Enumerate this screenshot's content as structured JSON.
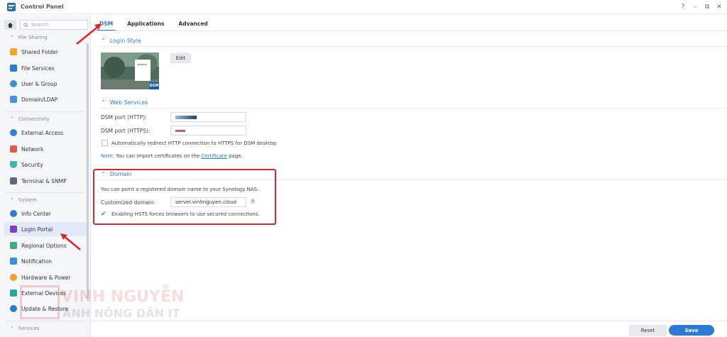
{
  "window": {
    "title": "Control Panel",
    "controls": [
      "?",
      "–",
      "⧉",
      "✕"
    ]
  },
  "sidebar": {
    "search_placeholder": "Search",
    "groups": [
      {
        "label": "File Sharing",
        "items": [
          {
            "label": "Shared Folder",
            "icon": "shared-folder-icon",
            "color": "#f5a623"
          },
          {
            "label": "File Services",
            "icon": "file-services-icon",
            "color": "#2b7bd6"
          },
          {
            "label": "User & Group",
            "icon": "user-group-icon",
            "color": "#3a8fd9"
          },
          {
            "label": "Domain/LDAP",
            "icon": "domain-ldap-icon",
            "color": "#4a90e2"
          }
        ]
      },
      {
        "label": "Connectivity",
        "items": [
          {
            "label": "External Access",
            "icon": "external-access-icon",
            "color": "#3a7bd5"
          },
          {
            "label": "Network",
            "icon": "network-icon",
            "color": "#e05a4e"
          },
          {
            "label": "Security",
            "icon": "security-icon",
            "color": "#3fb6a8"
          },
          {
            "label": "Terminal & SNMP",
            "icon": "terminal-icon",
            "color": "#5a6b7c"
          }
        ]
      },
      {
        "label": "System",
        "items": [
          {
            "label": "Info Center",
            "icon": "info-center-icon",
            "color": "#2b7bd6"
          },
          {
            "label": "Login Portal",
            "icon": "login-portal-icon",
            "color": "#7b3fc4"
          },
          {
            "label": "Regional Options",
            "icon": "regional-options-icon",
            "color": "#3db07a"
          },
          {
            "label": "Notification",
            "icon": "notification-icon",
            "color": "#3a8fd9"
          },
          {
            "label": "Hardware & Power",
            "icon": "hardware-power-icon",
            "color": "#f0a030"
          },
          {
            "label": "External Devices",
            "icon": "external-devices-icon",
            "color": "#2aa6a0"
          },
          {
            "label": "Update & Restore",
            "icon": "update-restore-icon",
            "color": "#2b7bd6"
          }
        ]
      },
      {
        "label": "Services",
        "items": []
      }
    ]
  },
  "tabs": [
    "DSM",
    "Applications",
    "Advanced"
  ],
  "login_style": {
    "heading": "Login Style",
    "edit_label": "Edit",
    "badge": "DSM"
  },
  "web_services": {
    "heading": "Web Services",
    "http_label": "DSM port (HTTP):",
    "https_label": "DSM port (HTTPS):",
    "redirect_label": "Automatically redirect HTTP connection to HTTPS for DSM desktop",
    "note_key": "Note:",
    "note_pre": "You can import certificates on the",
    "note_link": "Certificate",
    "note_post": "page."
  },
  "domain": {
    "heading": "Domain",
    "description": "You can point a registered domain name to your Synology NAS.",
    "custom_label": "Customized domain:",
    "custom_value": "server.vinhnguyen.cloud",
    "hsts_label": "Enabling HSTS forces browsers to use secured connections."
  },
  "footer": {
    "reset": "Reset",
    "save": "Save"
  },
  "watermark": {
    "line1": "VINH NGUYỄN",
    "line2": "ANH NÔNG DÂN IT"
  },
  "colors": {
    "accent": "#2b7bd6",
    "highlight_box": "#e0232a"
  }
}
